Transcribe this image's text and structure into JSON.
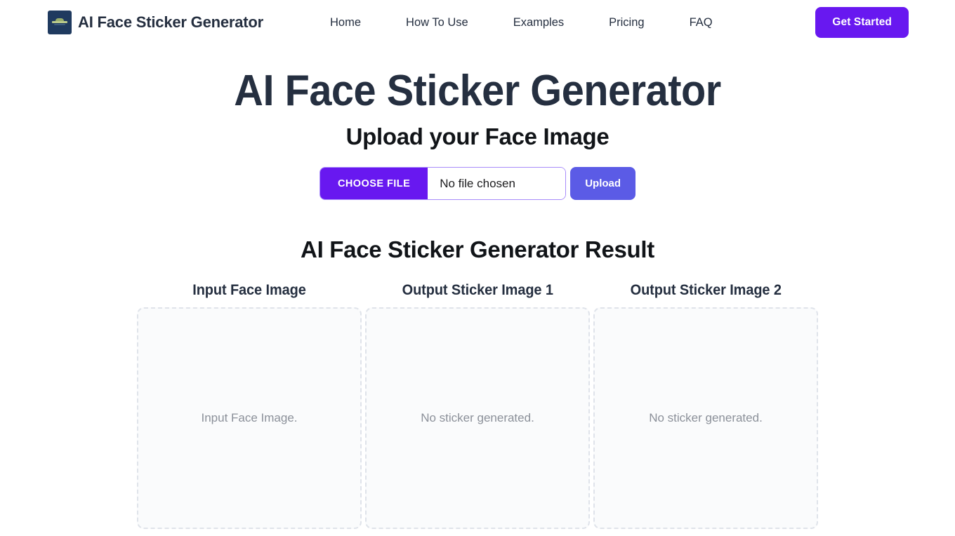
{
  "header": {
    "brand_name": "AI Face Sticker Generator",
    "logo_icon": "sticker-logo-icon",
    "nav_items": [
      {
        "label": "Home",
        "name": "nav-link-home"
      },
      {
        "label": "How To Use",
        "name": "nav-link-how-to-use"
      },
      {
        "label": "Examples",
        "name": "nav-link-examples"
      },
      {
        "label": "Pricing",
        "name": "nav-link-pricing"
      },
      {
        "label": "FAQ",
        "name": "nav-link-faq"
      }
    ],
    "cta_label": "Get Started"
  },
  "hero": {
    "title": "AI Face Sticker Generator",
    "subtitle": "Upload your Face Image"
  },
  "upload": {
    "choose_file_label": "CHOOSE FILE",
    "file_name_value": "No file chosen",
    "upload_label": "Upload"
  },
  "results": {
    "title": "AI Face Sticker Generator Result",
    "columns": [
      {
        "title": "Input Face Image",
        "placeholder": "Input Face Image."
      },
      {
        "title": "Output Sticker Image 1",
        "placeholder": "No sticker generated."
      },
      {
        "title": "Output Sticker Image 2",
        "placeholder": "No sticker generated."
      }
    ]
  },
  "colors": {
    "accent_violet": "#6818f0",
    "accent_indigo": "#5b5be6",
    "heading_navy": "#252f40",
    "logo_navy": "#1f3a5f",
    "placeholder_border": "#dfe3ea",
    "placeholder_text": "#8b9099"
  }
}
